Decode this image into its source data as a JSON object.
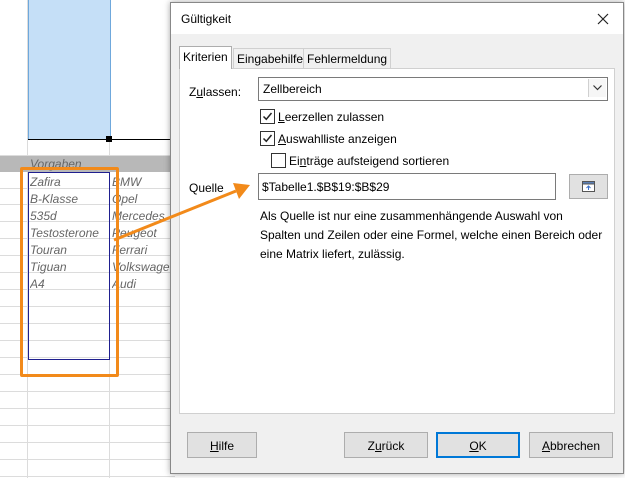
{
  "sheet": {
    "header_label": "Vorgaben",
    "column_b": [
      "Zafira",
      "B-Klasse",
      "535d",
      "Testosterone",
      "Touran",
      "Tiguan",
      "A4"
    ],
    "column_c": [
      "BMW",
      "Opel",
      "Mercedes",
      "Peugeot",
      "Ferrari",
      "Volkswage",
      "Audi"
    ]
  },
  "colors": {
    "selection": "#c5dff7",
    "highlight_annotation": "#f28a1a",
    "ok_focus": "#0078d7"
  },
  "dialog": {
    "title": "Gültigkeit",
    "close_icon": "close-icon",
    "tabs": [
      {
        "label": "Kriterien",
        "active": true
      },
      {
        "label": "Eingabehilfe",
        "active": false
      },
      {
        "label": "Fehlermeldung",
        "active": false
      }
    ],
    "zulassen": {
      "label_pre": "Z",
      "label_u": "u",
      "label_post": "lassen:",
      "value": "Zellbereich"
    },
    "checkboxes": [
      {
        "pre": "",
        "u": "L",
        "post": "eerzellen zulassen",
        "checked": true
      },
      {
        "pre": "",
        "u": "A",
        "post": "uswahlliste anzeigen",
        "checked": true
      },
      {
        "pre": "Ei",
        "u": "n",
        "post": "träge aufsteigend sortieren",
        "checked": false
      }
    ],
    "quelle": {
      "label": "Quelle",
      "value": "$Tabelle1.$B$19:$B$29",
      "shrink_icon": "shrink-icon"
    },
    "hint": "Als Quelle ist nur eine zusammenhängende Auswahl von Spalten und Zeilen oder eine Formel, welche einen Bereich oder eine Matrix liefert, zulässig.",
    "buttons": {
      "help": {
        "u": "H",
        "post": "ilfe"
      },
      "reset": {
        "pre": "Z",
        "u": "u",
        "post": "rück"
      },
      "ok": {
        "u": "O",
        "post": "K"
      },
      "cancel": {
        "u": "A",
        "post": "bbrechen"
      }
    }
  }
}
